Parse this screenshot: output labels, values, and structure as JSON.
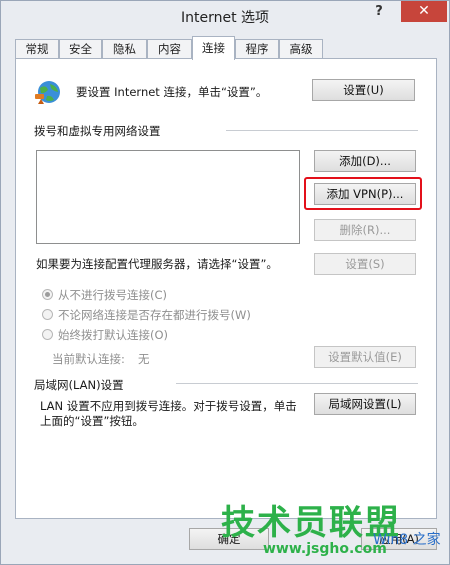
{
  "window": {
    "title": "Internet 选项",
    "help_label": "?",
    "close_label": "✕"
  },
  "tabs": [
    {
      "label": "常规"
    },
    {
      "label": "安全"
    },
    {
      "label": "隐私"
    },
    {
      "label": "内容"
    },
    {
      "label": "连接",
      "active": true
    },
    {
      "label": "程序"
    },
    {
      "label": "高级"
    }
  ],
  "setup": {
    "text": "要设置 Internet 连接，单击“设置”。",
    "button": "设置(U)",
    "icon": "network-globe-icon"
  },
  "dialup": {
    "section_title": "拨号和虚拟专用网络设置",
    "add_button": "添加(D)...",
    "add_vpn_button": "添加 VPN(P)...",
    "remove_button": "删除(R)...",
    "proxy_text": "如果要为连接配置代理服务器，请选择“设置”。",
    "settings_button": "设置(S)",
    "options": [
      {
        "label": "从不进行拨号连接(C)",
        "checked": true
      },
      {
        "label": "不论网络连接是否存在都进行拨号(W)",
        "checked": false
      },
      {
        "label": "始终拨打默认连接(O)",
        "checked": false
      }
    ],
    "current_default_label": "当前默认连接:",
    "current_default_value": "无",
    "set_default_button": "设置默认值(E)"
  },
  "lan": {
    "section_title": "局域网(LAN)设置",
    "description_line1": "LAN 设置不应用到拨号连接。对于拨号设置，单击",
    "description_line2": "上面的“设置”按钮。",
    "button": "局域网设置(L)"
  },
  "footer": {
    "ok_button": "确定",
    "apply_button": "应用(A)"
  },
  "watermark": {
    "brand": "技术员联盟",
    "url": "www.jsgho.com",
    "logo_text": "Win8 之家"
  },
  "colors": {
    "highlight": "#e3101a",
    "watermark_green": "#2db14a",
    "watermark_blue": "#2a6fc9",
    "close_red": "#c7453b"
  }
}
